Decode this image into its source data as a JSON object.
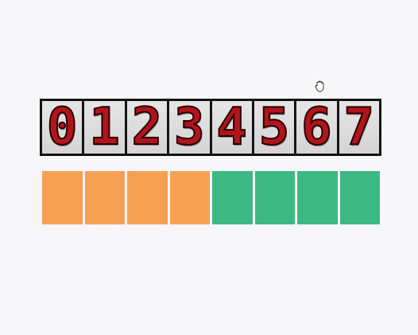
{
  "digits": [
    "0",
    "1",
    "2",
    "3",
    "4",
    "5",
    "6",
    "7"
  ],
  "blocks": [
    {
      "color": "#f7a054"
    },
    {
      "color": "#f7a054"
    },
    {
      "color": "#f7a054"
    },
    {
      "color": "#f7a054"
    },
    {
      "color": "#3cb983"
    },
    {
      "color": "#3cb983"
    },
    {
      "color": "#3cb983"
    },
    {
      "color": "#3cb983"
    }
  ],
  "cursor": {
    "icon": "grab-hand-icon"
  }
}
